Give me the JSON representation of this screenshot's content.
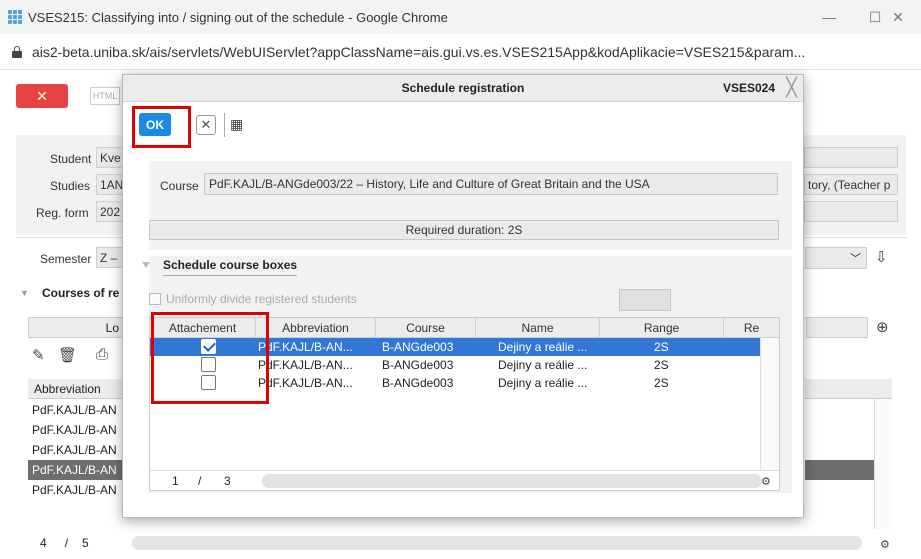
{
  "window": {
    "title": "VSES215: Classifying into / signing out of the schedule - Google Chrome",
    "url": "ais2-beta.uniba.sk/ais/servlets/WebUIServlet?appClassName=ais.gui.vs.es.VSES215App&kodAplikacie=VSES215&param...",
    "minimize": "—",
    "maximize": "☐",
    "close": "✕"
  },
  "background": {
    "close_label": "✕",
    "html_label": "HTML",
    "student_label": "Student",
    "student_value": "Kve",
    "studies_label": "Studies",
    "studies_value": "1AN",
    "studies_right": "tory, (Teacher p",
    "regform_label": "Reg. form",
    "regform_value": "202",
    "semester_label": "Semester",
    "semester_value": "Z –",
    "courses_section": "Courses of re",
    "column_header_l": "Lo",
    "table_header": "Abbreviation",
    "rows": [
      "PdF.KAJL/B-AN",
      "PdF.KAJL/B-AN",
      "PdF.KAJL/B-AN",
      "PdF.KAJL/B-AN",
      "PdF.KAJL/B-AN"
    ],
    "pager_current": "4",
    "pager_sep": "/",
    "pager_total": "5"
  },
  "modal": {
    "title": "Schedule registration",
    "code": "VSES024",
    "ok_label": "OK",
    "course_label": "Course",
    "course_value": "PdF.KAJL/B-ANGde003/22 – History, Life and Culture of Great Britain and the USA",
    "required_duration": "Required duration: 2S",
    "section_title": "Schedule course boxes",
    "uniform_checkbox_label": "Uniformly divide registered students",
    "grid": {
      "columns": [
        "Attachement",
        "Abbreviation",
        "Course",
        "Name",
        "Range",
        "Re"
      ],
      "rows": [
        {
          "attached": true,
          "abbreviation": "PdF.KAJL/B-AN...",
          "course": "B-ANGde003",
          "name": "Dejiny a reálie ...",
          "range": "2S"
        },
        {
          "attached": false,
          "abbreviation": "PdF.KAJL/B-AN...",
          "course": "B-ANGde003",
          "name": "Dejiny a reálie ...",
          "range": "2S"
        },
        {
          "attached": false,
          "abbreviation": "PdF.KAJL/B-AN...",
          "course": "B-ANGde003",
          "name": "Dejiny a reálie ...",
          "range": "2S"
        }
      ],
      "pager_current": "1",
      "pager_sep": "/",
      "pager_total": "3"
    }
  },
  "colors": {
    "ok_button": "#1a8ae6",
    "selected_row": "#3277d3",
    "close_button": "#e64444",
    "highlight_frame": "#e00000"
  }
}
